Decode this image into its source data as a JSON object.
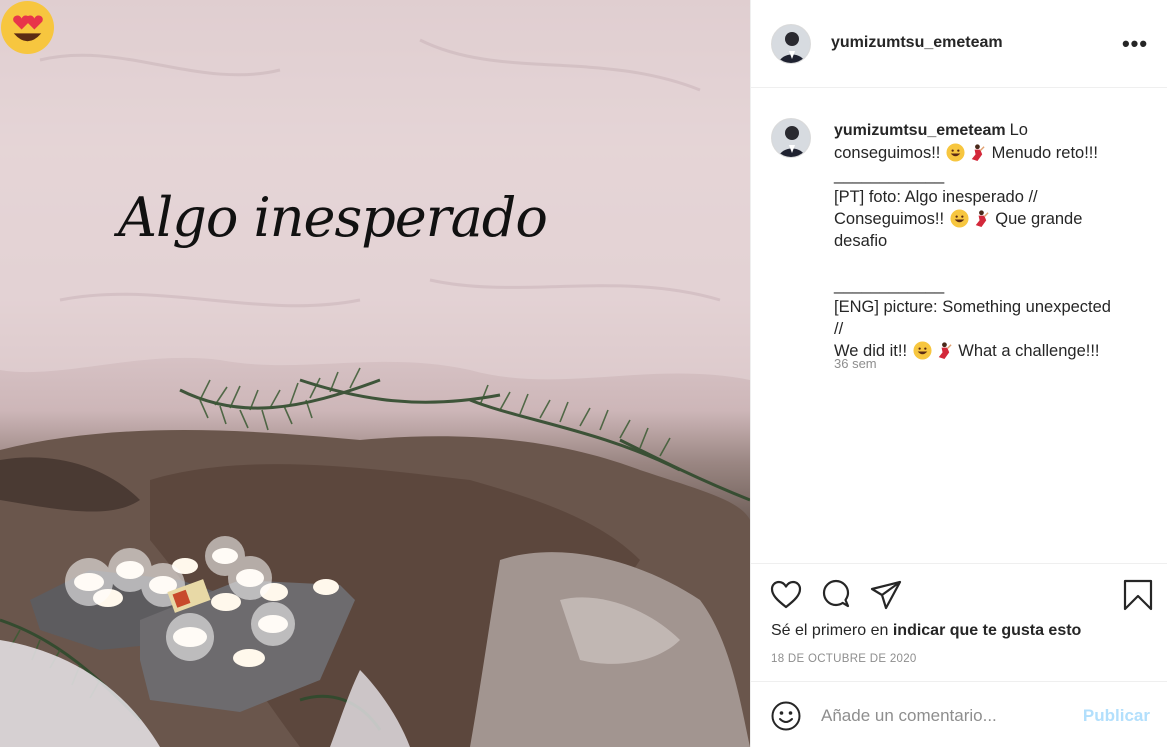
{
  "photo": {
    "overlay_text": "Algo inesperado",
    "overlay_emoji": "heart-eyes-emoji"
  },
  "post": {
    "username": "yumizumtsu_emeteam",
    "caption": {
      "line1": "Lo",
      "line2": "conseguimos!!",
      "line2_rest": "Menudo reto!!!",
      "divider1": "____________",
      "pt1": "[PT] foto: Algo inesperado //",
      "pt2": "Conseguimos!!",
      "pt2_rest": "Que grande",
      "pt3": "desafio",
      "divider2": "____________",
      "en1": "[ENG] picture: Something unexpected",
      "en2": "//",
      "en3": "We did it!!",
      "en3_rest": "What a challenge!!!"
    },
    "time_ago": "36 sem",
    "likes_prefix": "Sé el primero en ",
    "likes_link": "indicar que te gusta esto",
    "date": "18 DE OCTUBRE DE 2020"
  },
  "comment_box": {
    "placeholder": "Añade un comentario...",
    "publish_label": "Publicar"
  },
  "icons": {
    "more": "more-options-icon",
    "like": "heart-icon",
    "comment": "comment-icon",
    "share": "paper-plane-icon",
    "save": "bookmark-icon",
    "emoji": "smiley-icon"
  },
  "colors": {
    "text": "#262626",
    "muted": "#8e8e8e",
    "publish_disabled": "#b2dffc",
    "border": "#efefef"
  }
}
